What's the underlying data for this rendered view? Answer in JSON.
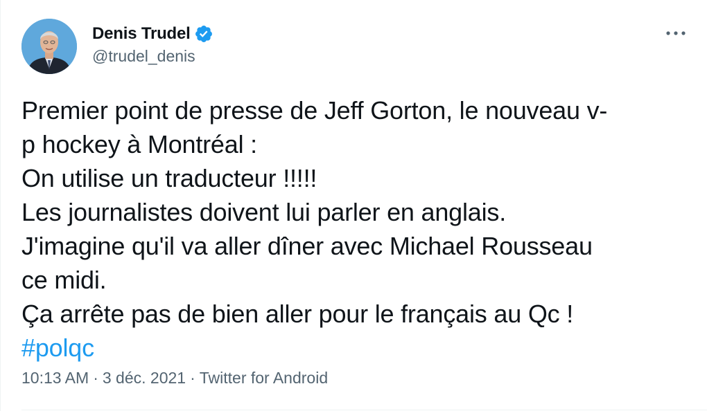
{
  "author": {
    "display_name": "Denis Trudel",
    "handle": "@trudel_denis",
    "verified_icon": "verified-badge-icon",
    "avatar_icon": "profile-photo"
  },
  "more_icon": "more-dots-icon",
  "tweet": {
    "lines": [
      "Premier point de presse de Jeff Gorton, le nouveau v-",
      "p hockey à Montréal :",
      "On utilise un traducteur !!!!!",
      "Les journalistes doivent lui parler en anglais.",
      "J'imagine qu'il va aller dîner avec Michael Rousseau",
      "ce midi.",
      "Ça arrête pas de bien aller pour le français au Qc !"
    ],
    "hashtag": "#polqc"
  },
  "meta": {
    "time": "10:13 AM",
    "separator": "·",
    "date": "3 déc. 2021",
    "source": "Twitter for Android"
  },
  "colors": {
    "text": "#0f1419",
    "secondary": "#536471",
    "link": "#1d9bf0",
    "verified": "#1d9bf0"
  }
}
